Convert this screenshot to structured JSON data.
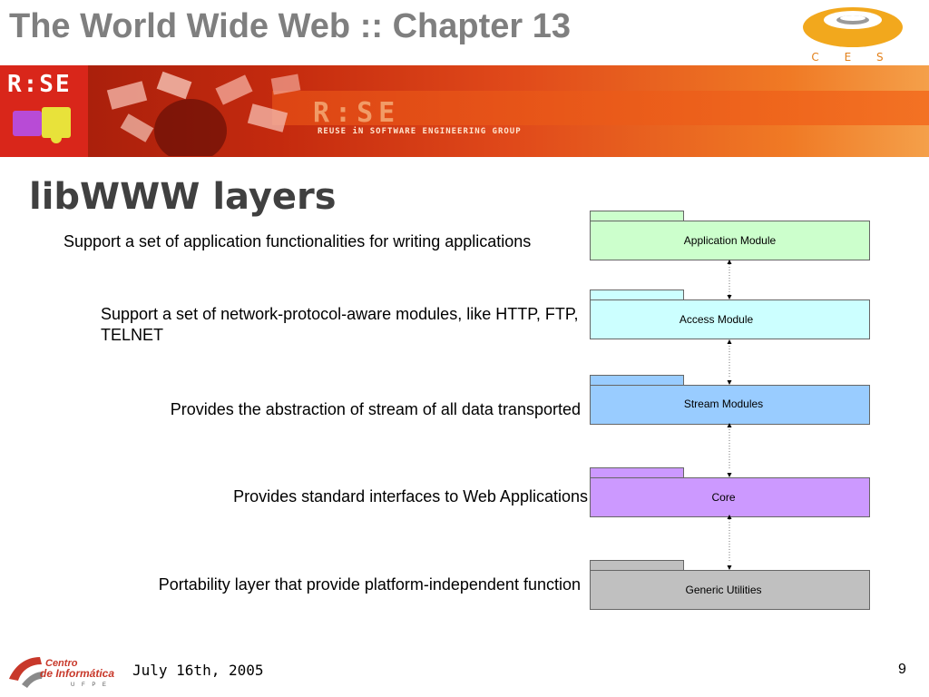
{
  "slide": {
    "title": "The World Wide Web :: Chapter 13",
    "heading": "libWWW layers",
    "footer_date": "July 16th, 2005",
    "page_number": "9"
  },
  "logos": {
    "cesar_text": "C E S A R",
    "rise_small": "R:SE",
    "rise_big": "R:SE",
    "rise_tagline": "REUSE iN SOFTWARE ENGINEERING GROUP",
    "centro_line1": "Centro",
    "centro_line2": "de Informática",
    "centro_line3": "U F P E"
  },
  "layers": [
    {
      "label": "Application Module",
      "description": "Support a set of application functionalities for writing applications",
      "color": "#ccffcc"
    },
    {
      "label": "Access Module",
      "description": "Support a set of network-protocol-aware modules, like HTTP, FTP, TELNET",
      "color": "#ccffff"
    },
    {
      "label": "Stream Modules",
      "description": "Provides  the abstraction of stream of all data transported",
      "color": "#99ccff"
    },
    {
      "label": "Core",
      "description": "Provides standard interfaces to Web Applications",
      "color": "#cc99ff"
    },
    {
      "label": "Generic Utilities",
      "description": "Portability layer that provide platform-independent function",
      "color": "#c0c0c0"
    }
  ]
}
